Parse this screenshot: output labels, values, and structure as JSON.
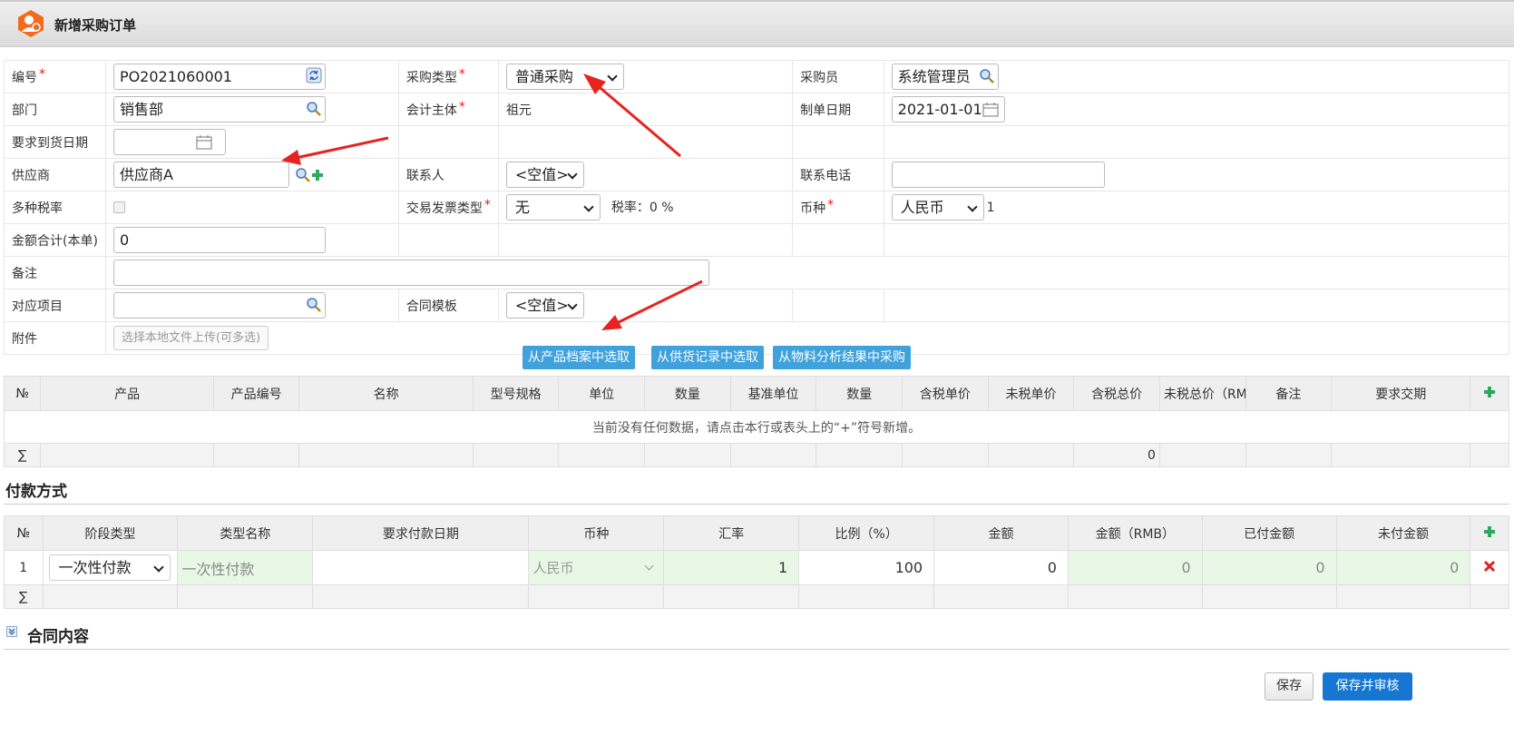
{
  "window": {
    "title": "新增采购订单"
  },
  "form": {
    "no_label": "编号",
    "no_value": "PO2021060001",
    "type_label": "采购类型",
    "type_value": "普通采购",
    "buyer_label": "采购员",
    "buyer_value": "系统管理员",
    "dept_label": "部门",
    "dept_value": "销售部",
    "entity_label": "会计主体",
    "entity_value": "祖元",
    "date_label": "制单日期",
    "date_value": "2021-01-01",
    "delivery_label": "要求到货日期",
    "supplier_label": "供应商",
    "supplier_value": "供应商A",
    "contact_label": "联系人",
    "contact_value": "<空值>",
    "phone_label": "联系电话",
    "multitax_label": "多种税率",
    "invoice_label": "交易发票类型",
    "invoice_value": "无",
    "taxrate_text": "税率：0 %",
    "currency_label": "币种",
    "currency_value": "人民币",
    "currency_rate": "1",
    "total_label": "金额合计(本单)",
    "total_value": "0",
    "remark_label": "备注",
    "project_label": "对应项目",
    "contract_tpl_label": "合同模板",
    "contract_tpl_value": "<空值>",
    "attach_label": "附件",
    "attach_button": "选择本地文件上传(可多选)"
  },
  "source_buttons": [
    "从产品档案中选取",
    "从供货记录中选取",
    "从物料分析结果中采购"
  ],
  "products": {
    "headers": [
      "№",
      "产品",
      "产品编号",
      "名称",
      "型号规格",
      "单位",
      "数量",
      "基准单位",
      "数量",
      "含税单价",
      "未税单价",
      "含税总价",
      "未税总价（RM",
      "备注",
      "要求交期"
    ],
    "empty_text": "当前没有任何数据，请点击本行或表头上的“+”符号新增。",
    "sum_symbol": "∑",
    "sum_total": "0"
  },
  "payment": {
    "title": "付款方式",
    "headers": [
      "№",
      "阶段类型",
      "类型名称",
      "要求付款日期",
      "币种",
      "汇率",
      "比例（%）",
      "金额",
      "金额（RMB）",
      "已付金额",
      "未付金额"
    ],
    "row": {
      "no": "1",
      "stage": "一次性付款",
      "type_name": "一次性付款",
      "date": "",
      "currency": "人民币",
      "rate": "1",
      "ratio": "100",
      "amount": "0",
      "amount_rmb": "0",
      "paid": "0",
      "unpaid": "0"
    },
    "sum_symbol": "∑"
  },
  "contract": {
    "title": "合同内容"
  },
  "buttons": {
    "save": "保存",
    "save_audit": "保存并审核"
  },
  "colors": {
    "accent": "#1677d2",
    "source_btn": "#3fa2dc",
    "required": "#e02020",
    "green_cell": "#e9f8e6",
    "arrow": "#e8231f"
  }
}
